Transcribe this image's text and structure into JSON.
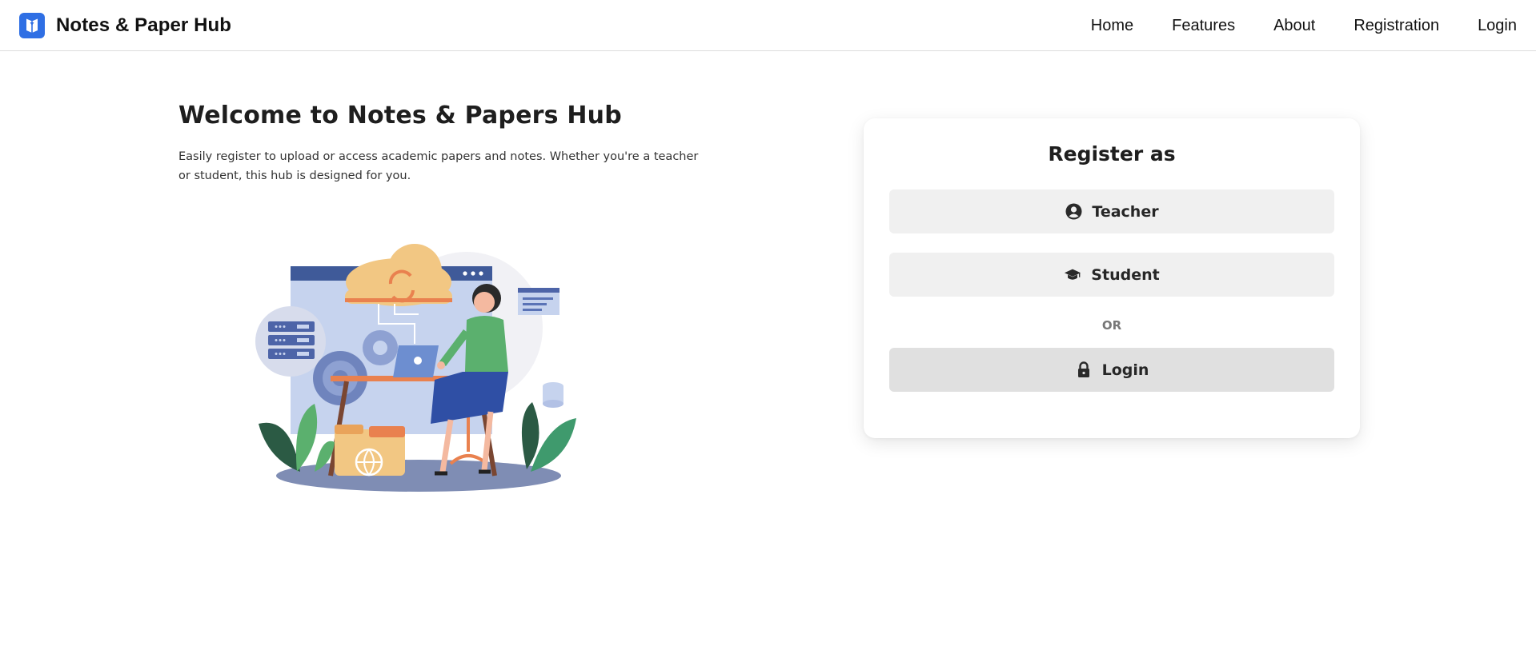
{
  "navbar": {
    "brand": "Notes & Paper Hub",
    "links": [
      "Home",
      "Features",
      "About",
      "Registration",
      "Login"
    ]
  },
  "hero": {
    "title": "Welcome to Notes & Papers Hub",
    "description": "Easily register to upload or access academic papers and notes. Whether you're a teacher or student, this hub is designed for you."
  },
  "register_card": {
    "title": "Register as",
    "teacher_label": "Teacher",
    "student_label": "Student",
    "or_text": "OR",
    "login_label": "Login"
  },
  "icons": {
    "brand": "book-icon",
    "teacher": "user-circle-icon",
    "student": "graduation-cap-icon",
    "login": "lock-icon"
  },
  "colors": {
    "brand_accent": "#2f6fe4",
    "button_bg": "#f0f0f0",
    "login_button_bg": "#e0e0e0"
  }
}
